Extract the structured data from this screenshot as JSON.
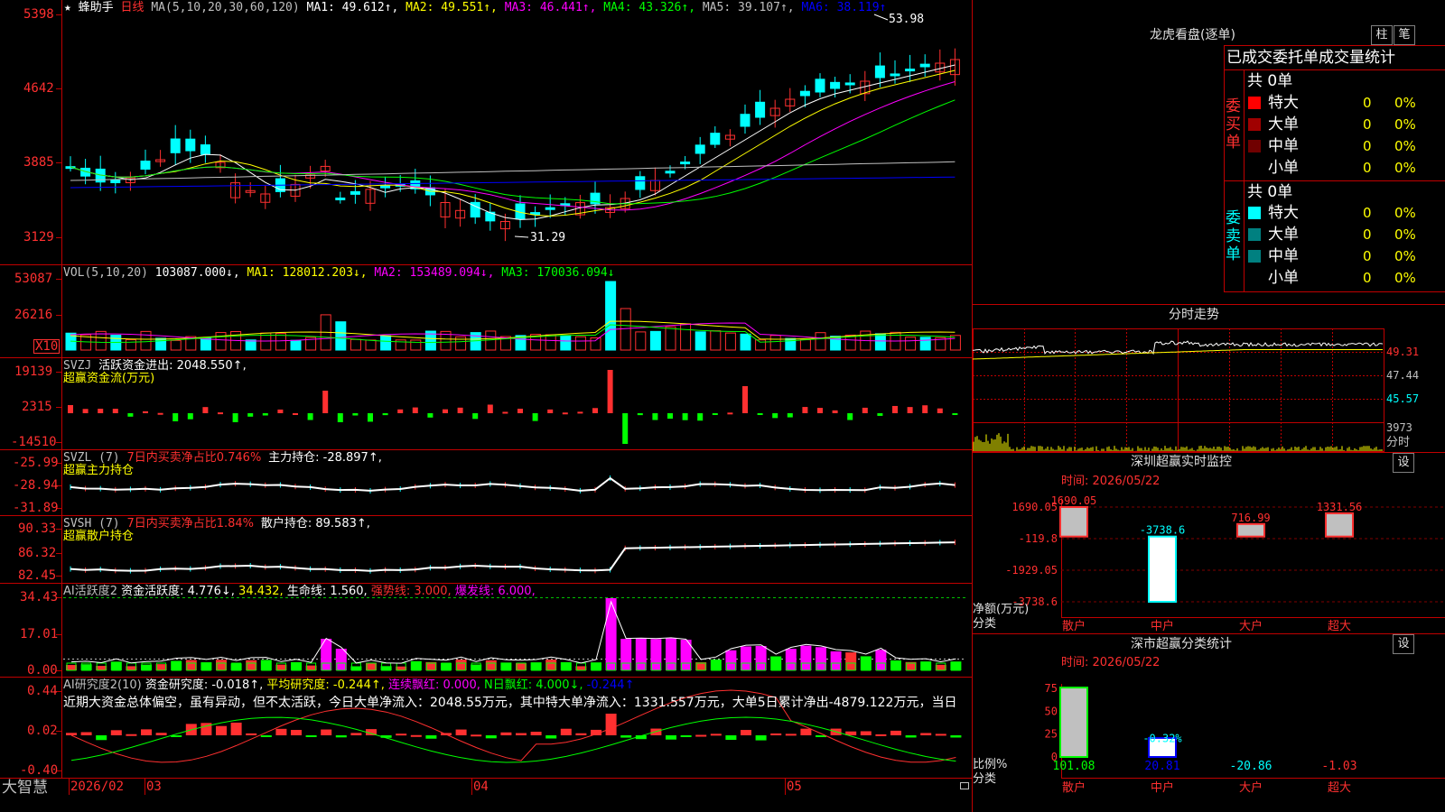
{
  "colors": {
    "up": "#ff3030",
    "down": "#00ffff",
    "ma1": "#ffffff",
    "ma2": "#ffff00",
    "ma3": "#ff00ff",
    "ma4": "#00ff00",
    "ma5": "#c0c0c0",
    "ma6": "#0000ff",
    "grid": "#c00000",
    "green": "#00ff00",
    "magenta": "#ff00ff"
  },
  "main_panel": {
    "title_icon": "star-icon",
    "star": "★",
    "name": "蜂助手",
    "period": "日线",
    "ma_label": "MA(5,10,20,30,60,120)",
    "ma1": "MA1: 49.612↑,",
    "ma2": "MA2: 49.551↑,",
    "ma3": "MA3: 46.441↑,",
    "ma4": "MA4: 43.326↑,",
    "ma5": "MA5: 39.107↑,",
    "ma6": "MA6: 38.119↑",
    "high_mark": "53.98",
    "low_mark": "31.29",
    "yticks": [
      "5398",
      "4642",
      "3885",
      "3129"
    ]
  },
  "vol_panel": {
    "label": "VOL(5,10,20)",
    "value": "103087.000↓,",
    "ma1": "MA1: 128012.203↓,",
    "ma2": "MA2: 153489.094↓,",
    "ma3": "MA3: 170036.094↓",
    "yticks": [
      "53087",
      "26216"
    ],
    "unit": "X10"
  },
  "svzj_panel": {
    "label": "SVZJ",
    "text": "活跃资金进出: 2048.550↑,",
    "sub": "超赢资金流(万元)",
    "yticks": [
      "19139",
      "2315",
      "-14510"
    ]
  },
  "svzl_panel": {
    "label": "SVZL (7)",
    "ratio": "7日内买卖净占比0.746%",
    "text": "主力持仓: -28.897↑,",
    "sub": "超赢主力持仓",
    "yticks": [
      "-25.99",
      "-28.94",
      "-31.89"
    ]
  },
  "svsh_panel": {
    "label": "SVSH (7)",
    "ratio": "7日内买卖净占比1.84%",
    "text": "散户持仓: 89.583↑,",
    "sub": "超赢散户持仓",
    "yticks": [
      "90.33",
      "86.32",
      "82.45"
    ]
  },
  "ai1_panel": {
    "label": "AI活跃度2",
    "t1": "资金活跃度: 4.776↓,",
    "t2": "34.432,",
    "t3": "生命线: 1.560,",
    "t4": "强势线: 3.000,",
    "t5": "爆发线: 6.000,",
    "yticks": [
      "34.43",
      "17.01",
      "0.00"
    ]
  },
  "ai2_panel": {
    "label": "AI研究度2(10)",
    "t1": "资金研究度: -0.018↑,",
    "t2": "平均研究度: -0.244↑,",
    "t3": "连续飘红: 0.000,",
    "t4": "N日飘红: 4.000↓,",
    "t5": "-0.244↑",
    "summary": "近期大资金总体偏空，虽有异动，但不太活跃，今日大单净流入：2048.55万元，其中特大单净流入：1331.557万元，大单5日累计净出-4879.122万元，当日",
    "yticks": [
      "0.44",
      "0.02",
      "-0.40"
    ]
  },
  "bottom_bar": {
    "brand": "大智慧",
    "date": "2026/02",
    "m3": "03",
    "m4": "04",
    "m5": "05"
  },
  "longhu": {
    "title": "龙虎看盘(逐单)",
    "btn_zhu": "柱",
    "btn_bi": "笔",
    "tabs": "已成交委托单成交量统计",
    "buy_label": "委买单",
    "sell_label": "委卖单",
    "buy_total": "共 0单",
    "sell_total": "共 0单",
    "buy_rows": [
      {
        "name": "特大",
        "count": "0",
        "pct": "0%",
        "color": "#ff0000"
      },
      {
        "name": "大单",
        "count": "0",
        "pct": "0%",
        "color": "#a00000"
      },
      {
        "name": "中单",
        "count": "0",
        "pct": "0%",
        "color": "#700000"
      },
      {
        "name": "小单",
        "count": "0",
        "pct": "0%",
        "color": "#000000"
      }
    ],
    "sell_rows": [
      {
        "name": "特大",
        "count": "0",
        "pct": "0%",
        "color": "#00ffff"
      },
      {
        "name": "大单",
        "count": "0",
        "pct": "0%",
        "color": "#008080"
      },
      {
        "name": "中单",
        "count": "0",
        "pct": "0%",
        "color": "#008080"
      },
      {
        "name": "小单",
        "count": "0",
        "pct": "0%",
        "color": "#000000"
      }
    ]
  },
  "fenshi": {
    "title": "分时走势",
    "yticks": [
      "49.31",
      "47.44",
      "45.57"
    ],
    "vol": "3973",
    "vol_unit": "分时"
  },
  "sz_monitor": {
    "title": "深圳超赢实时监控",
    "btn": "设",
    "time": "时间: 2026/05/22",
    "yticks": [
      "1690.05",
      "-119.8",
      "-1929.05",
      "-3738.6"
    ],
    "ylabel": "净额(万元)",
    "xlabel": "分类",
    "bars": [
      {
        "name": "散户",
        "value": 1690.05,
        "label": "1690.05"
      },
      {
        "name": "中户",
        "value": -3738.6,
        "label": "-3738.6"
      },
      {
        "name": "大户",
        "value": 716.99,
        "label": "716.99"
      },
      {
        "name": "超大",
        "value": 1331.56,
        "label": "1331.56"
      }
    ]
  },
  "sz_class": {
    "title": "深市超赢分类统计",
    "btn": "设",
    "time": "时间: 2026/05/22",
    "yticks": [
      "75",
      "50",
      "25",
      "0"
    ],
    "ylabel": "比例%",
    "xlabel": "分类",
    "bars": [
      {
        "name": "散户",
        "value": 101.08,
        "label": "101.08"
      },
      {
        "name": "中户",
        "value": 20.81,
        "label": "20.81",
        "top": "-0.32%"
      },
      {
        "name": "大户",
        "value": -20.86,
        "label": "-20.86"
      },
      {
        "name": "超大",
        "value": -1.03,
        "label": "-1.03"
      }
    ]
  },
  "chart_data": [
    {
      "type": "bar",
      "title": "深圳超赢实时监控",
      "categories": [
        "散户",
        "中户",
        "大户",
        "超大"
      ],
      "values": [
        1690.05,
        -3738.6,
        716.99,
        1331.56
      ],
      "ylabel": "净额(万元)",
      "xlabel": "分类",
      "ylim": [
        -3738.6,
        1690.05
      ]
    },
    {
      "type": "bar",
      "title": "深市超赢分类统计",
      "categories": [
        "散户",
        "中户",
        "大户",
        "超大"
      ],
      "values": [
        101.08,
        20.81,
        -20.86,
        -1.03
      ],
      "ylabel": "比例%",
      "xlabel": "分类",
      "ylim": [
        0,
        75
      ]
    }
  ]
}
